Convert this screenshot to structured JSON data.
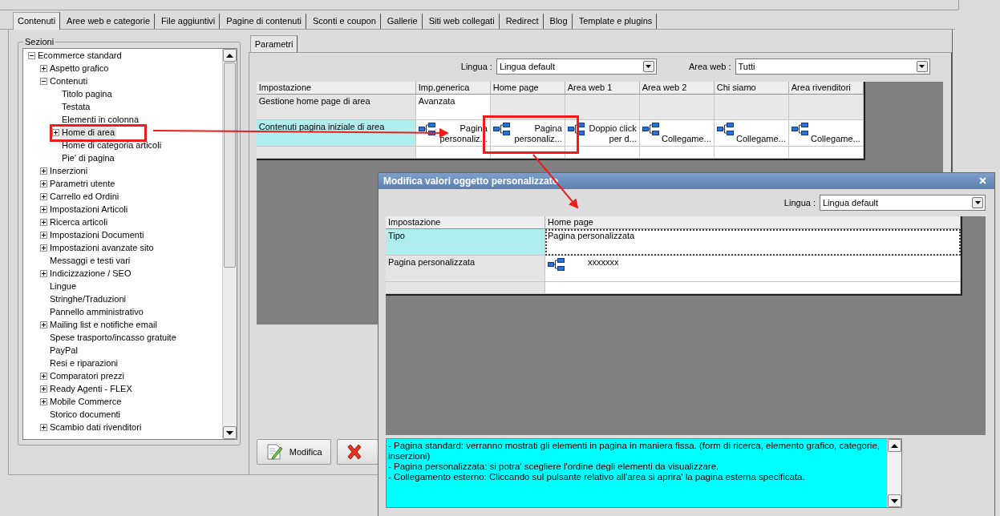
{
  "top_tabs": [
    {
      "label": "Contenuti",
      "selected": true
    },
    {
      "label": "Aree web e categorie",
      "selected": false
    },
    {
      "label": "File aggiuntivi",
      "selected": false
    },
    {
      "label": "Pagine di contenuti",
      "selected": false
    },
    {
      "label": "Sconti e coupon",
      "selected": false
    },
    {
      "label": "Gallerie",
      "selected": false
    },
    {
      "label": "Siti web collegati",
      "selected": false
    },
    {
      "label": "Redirect",
      "selected": false
    },
    {
      "label": "Blog",
      "selected": false
    },
    {
      "label": "Template e plugins",
      "selected": false
    }
  ],
  "sections": {
    "title": "Sezioni",
    "tree": [
      {
        "label": "Ecommerce standard",
        "kind": "branch",
        "expanded": true,
        "selected": false,
        "children": [
          {
            "label": "Aspetto grafico",
            "kind": "branch",
            "expanded": false,
            "selected": false
          },
          {
            "label": "Contenuti",
            "kind": "branch",
            "expanded": true,
            "selected": false,
            "children": [
              {
                "label": "Titolo pagina",
                "kind": "leaf",
                "selected": false
              },
              {
                "label": "Testata",
                "kind": "leaf",
                "selected": false
              },
              {
                "label": "Elementi in colonna",
                "kind": "leaf",
                "selected": false
              },
              {
                "label": "Home di area",
                "kind": "branch",
                "expanded": false,
                "selected": true
              },
              {
                "label": "Home di categoria articoli",
                "kind": "leaf",
                "selected": false
              },
              {
                "label": "Pie' di pagina",
                "kind": "leaf",
                "selected": false
              }
            ]
          },
          {
            "label": "Inserzioni",
            "kind": "branch",
            "expanded": false,
            "selected": false
          },
          {
            "label": "Parametri utente",
            "kind": "branch",
            "expanded": false,
            "selected": false
          },
          {
            "label": "Carrello ed Ordini",
            "kind": "branch",
            "expanded": false,
            "selected": false
          },
          {
            "label": "Impostazioni Articoli",
            "kind": "branch",
            "expanded": false,
            "selected": false
          },
          {
            "label": "Ricerca articoli",
            "kind": "branch",
            "expanded": false,
            "selected": false
          },
          {
            "label": "Impostazioni Documenti",
            "kind": "branch",
            "expanded": false,
            "selected": false
          },
          {
            "label": "Impostazioni avanzate sito",
            "kind": "branch",
            "expanded": false,
            "selected": false
          },
          {
            "label": "Messaggi e testi vari",
            "kind": "leaf",
            "selected": false
          },
          {
            "label": "Indicizzazione / SEO",
            "kind": "branch",
            "expanded": false,
            "selected": false
          },
          {
            "label": "Lingue",
            "kind": "leaf",
            "selected": false
          },
          {
            "label": "Stringhe/Traduzioni",
            "kind": "leaf",
            "selected": false
          },
          {
            "label": "Pannello amministrativo",
            "kind": "leaf",
            "selected": false
          },
          {
            "label": "Mailing list e notifiche email",
            "kind": "branch",
            "expanded": false,
            "selected": false
          },
          {
            "label": "Spese trasporto/incasso gratuite",
            "kind": "leaf",
            "selected": false
          },
          {
            "label": "PayPal",
            "kind": "leaf",
            "selected": false
          },
          {
            "label": "Resi e riparazioni",
            "kind": "leaf",
            "selected": false
          },
          {
            "label": "Comparatori prezzi",
            "kind": "branch",
            "expanded": false,
            "selected": false
          },
          {
            "label": "Ready Agenti - FLEX",
            "kind": "branch",
            "expanded": false,
            "selected": false
          },
          {
            "label": "Mobile Commerce",
            "kind": "branch",
            "expanded": false,
            "selected": false
          },
          {
            "label": "Storico documenti",
            "kind": "leaf",
            "selected": false
          },
          {
            "label": "Scambio dati rivenditori",
            "kind": "branch",
            "expanded": false,
            "selected": false
          }
        ]
      }
    ]
  },
  "panel_tabs": [
    {
      "label": "Parametri",
      "selected": true
    }
  ],
  "filters": [
    {
      "label": "Lingua :",
      "value": "Lingua default"
    },
    {
      "label": "Area web :",
      "value": "Tutti"
    }
  ],
  "grid": {
    "columns": [
      "Impostazione",
      "Imp.generica",
      "Home page",
      "Area web 1",
      "Area web 2",
      "Chi siamo",
      "Area rivenditori"
    ],
    "rows": [
      {
        "selected": false,
        "cells": [
          {
            "kind": "text",
            "text": "Gestione home page di area"
          },
          {
            "kind": "text",
            "text": "Avanzata"
          },
          {
            "kind": "na"
          },
          {
            "kind": "na"
          },
          {
            "kind": "na"
          },
          {
            "kind": "na"
          },
          {
            "kind": "na"
          }
        ]
      },
      {
        "selected": true,
        "cells": [
          {
            "kind": "text",
            "text": "Contenuti pagina iniziale di area"
          },
          {
            "kind": "link",
            "text": "Pagina personaliz..."
          },
          {
            "kind": "link",
            "text": "Pagina personaliz..."
          },
          {
            "kind": "link",
            "text": "Doppio click per d..."
          },
          {
            "kind": "link",
            "text": "Collegame..."
          },
          {
            "kind": "link",
            "text": "Collegame..."
          },
          {
            "kind": "link",
            "text": "Collegame..."
          }
        ]
      }
    ]
  },
  "buttons": [
    {
      "kind": "edit",
      "label": "Modifica"
    },
    {
      "kind": "delete"
    }
  ],
  "dialog": {
    "title": "Modifica valori oggetto personalizzato",
    "filter": {
      "label": "Lingua :",
      "value": "Lingua default"
    },
    "grid": {
      "columns": [
        "Impostazione",
        "Home page"
      ],
      "rows": [
        {
          "selected": true,
          "cells": [
            {
              "kind": "text",
              "text": "Tipo",
              "focused": false
            },
            {
              "kind": "text",
              "text": "Pagina personalizzata",
              "focused": true
            }
          ]
        },
        {
          "selected": false,
          "cells": [
            {
              "kind": "text",
              "text": "Pagina personalizzata",
              "focused": false
            },
            {
              "kind": "link",
              "text": "xxxxxxx",
              "focused": false
            }
          ]
        }
      ]
    },
    "description": [
      "- Pagina standard: verranno mostrati gli elementi in pagina in maniera fissa. (form di ricerca, elemento grafico, categorie, inserzioni)",
      "- Pagina personalizzata: si potra' scegliere l'ordine degli elementi da visualizzare.",
      "- Collegamento esterno: Cliccando sul pulsante relativo all'area si aprira' la pagina esterna specificata."
    ]
  }
}
